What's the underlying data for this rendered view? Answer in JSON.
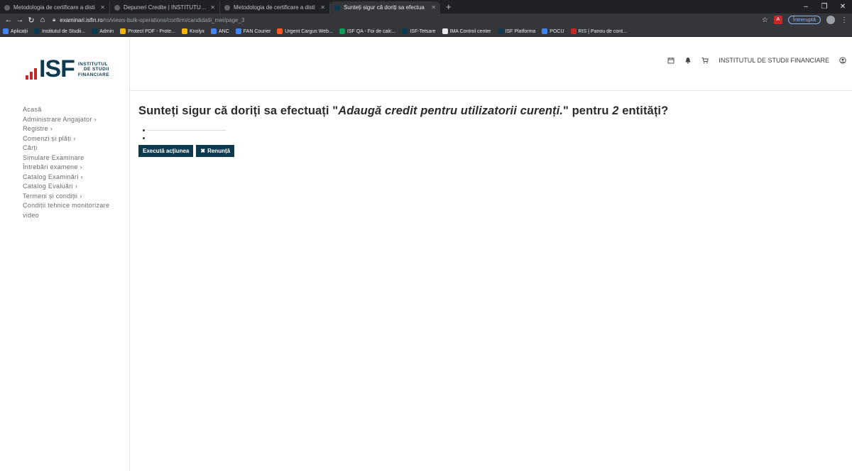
{
  "browser": {
    "tabs": [
      {
        "title": "Metodologia de certificare a disti"
      },
      {
        "title": "Depuneri Credite | INSTITUTUL D"
      },
      {
        "title": "Metodologia de certificare a disti"
      },
      {
        "title": "Sunteți sigur că doriți sa efectua"
      }
    ],
    "new_tab": "+",
    "url_host": "examinari.isfin.ro",
    "url_path": "/ro/views-bulk-operations/confirm/candidatii_mei/page_3",
    "paused_label": "Întreruptă",
    "bookmarks": [
      {
        "label": "Aplicații",
        "color": "#4285f4"
      },
      {
        "label": "Institutul de Studii...",
        "color": "#0e3a4f"
      },
      {
        "label": "Admin",
        "color": "#0e3a4f"
      },
      {
        "label": "Protect PDF - Prote...",
        "color": "#f4b400"
      },
      {
        "label": "Knolyx",
        "color": "#f4b400"
      },
      {
        "label": "ANC",
        "color": "#4285f4"
      },
      {
        "label": "FAN Courier",
        "color": "#4285f4"
      },
      {
        "label": "Urgent Cargus Web...",
        "color": "#ff5722"
      },
      {
        "label": "ISF QA - Foi de calc...",
        "color": "#0f9d58"
      },
      {
        "label": "ISF-Tetsare",
        "color": "#0e3a4f"
      },
      {
        "label": "IMA Control center",
        "color": "#e8eaed"
      },
      {
        "label": "ISF Platforma",
        "color": "#0e3a4f"
      },
      {
        "label": "POCU",
        "color": "#4285f4"
      },
      {
        "label": "RIS | Panou de cont...",
        "color": "#c62828"
      }
    ]
  },
  "header": {
    "logo_text": "ISF",
    "logo_sub": [
      "INSTITUTUL",
      "DE STUDII",
      "FINANCIARE"
    ],
    "org_name": "INSTITUTUL DE STUDII FINANCIARE"
  },
  "sidebar": {
    "items": [
      {
        "label": "Acasă",
        "chev": ""
      },
      {
        "label": "Administrare Angajator",
        "chev": "›"
      },
      {
        "label": "Registre",
        "chev": "›"
      },
      {
        "label": "Comenzi și plăți",
        "chev": "›"
      },
      {
        "label": "Cărți",
        "chev": ""
      },
      {
        "label": "Simulare Examinare",
        "chev": ""
      },
      {
        "label": "Întrebări examene",
        "chev": "›"
      },
      {
        "label": "Catalog Examinări",
        "chev": "›"
      },
      {
        "label": "Catalog Evaluări",
        "chev": "›"
      },
      {
        "label": "Termeni și condiții",
        "chev": "›"
      },
      {
        "label": "Condiții tehnice monitorizare video",
        "chev": ""
      }
    ]
  },
  "main": {
    "heading_pre": "Sunteți sigur că doriți sa efectuați \"",
    "heading_action": "Adaugă credit pentru utilizatorii curenți.",
    "heading_mid": "\" pentru ",
    "heading_count": "2",
    "heading_post": " entități?",
    "execute_label": "Execută acțiunea",
    "cancel_label": "Renunță",
    "cancel_icon": "✖"
  },
  "colors": {
    "brand_navy": "#0e3a4f",
    "brand_red": "#c62828"
  }
}
